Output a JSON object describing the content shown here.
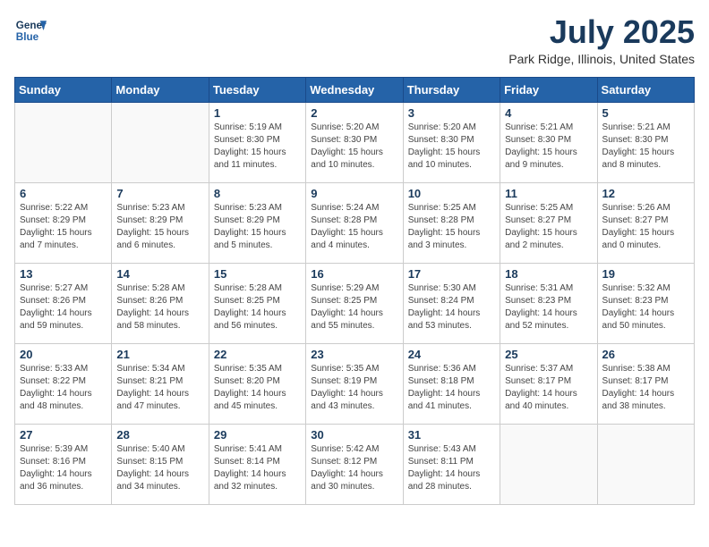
{
  "header": {
    "logo_line1": "General",
    "logo_line2": "Blue",
    "month": "July 2025",
    "location": "Park Ridge, Illinois, United States"
  },
  "weekdays": [
    "Sunday",
    "Monday",
    "Tuesday",
    "Wednesday",
    "Thursday",
    "Friday",
    "Saturday"
  ],
  "weeks": [
    [
      {
        "day": "",
        "info": ""
      },
      {
        "day": "",
        "info": ""
      },
      {
        "day": "1",
        "info": "Sunrise: 5:19 AM\nSunset: 8:30 PM\nDaylight: 15 hours and 11 minutes."
      },
      {
        "day": "2",
        "info": "Sunrise: 5:20 AM\nSunset: 8:30 PM\nDaylight: 15 hours and 10 minutes."
      },
      {
        "day": "3",
        "info": "Sunrise: 5:20 AM\nSunset: 8:30 PM\nDaylight: 15 hours and 10 minutes."
      },
      {
        "day": "4",
        "info": "Sunrise: 5:21 AM\nSunset: 8:30 PM\nDaylight: 15 hours and 9 minutes."
      },
      {
        "day": "5",
        "info": "Sunrise: 5:21 AM\nSunset: 8:30 PM\nDaylight: 15 hours and 8 minutes."
      }
    ],
    [
      {
        "day": "6",
        "info": "Sunrise: 5:22 AM\nSunset: 8:29 PM\nDaylight: 15 hours and 7 minutes."
      },
      {
        "day": "7",
        "info": "Sunrise: 5:23 AM\nSunset: 8:29 PM\nDaylight: 15 hours and 6 minutes."
      },
      {
        "day": "8",
        "info": "Sunrise: 5:23 AM\nSunset: 8:29 PM\nDaylight: 15 hours and 5 minutes."
      },
      {
        "day": "9",
        "info": "Sunrise: 5:24 AM\nSunset: 8:28 PM\nDaylight: 15 hours and 4 minutes."
      },
      {
        "day": "10",
        "info": "Sunrise: 5:25 AM\nSunset: 8:28 PM\nDaylight: 15 hours and 3 minutes."
      },
      {
        "day": "11",
        "info": "Sunrise: 5:25 AM\nSunset: 8:27 PM\nDaylight: 15 hours and 2 minutes."
      },
      {
        "day": "12",
        "info": "Sunrise: 5:26 AM\nSunset: 8:27 PM\nDaylight: 15 hours and 0 minutes."
      }
    ],
    [
      {
        "day": "13",
        "info": "Sunrise: 5:27 AM\nSunset: 8:26 PM\nDaylight: 14 hours and 59 minutes."
      },
      {
        "day": "14",
        "info": "Sunrise: 5:28 AM\nSunset: 8:26 PM\nDaylight: 14 hours and 58 minutes."
      },
      {
        "day": "15",
        "info": "Sunrise: 5:28 AM\nSunset: 8:25 PM\nDaylight: 14 hours and 56 minutes."
      },
      {
        "day": "16",
        "info": "Sunrise: 5:29 AM\nSunset: 8:25 PM\nDaylight: 14 hours and 55 minutes."
      },
      {
        "day": "17",
        "info": "Sunrise: 5:30 AM\nSunset: 8:24 PM\nDaylight: 14 hours and 53 minutes."
      },
      {
        "day": "18",
        "info": "Sunrise: 5:31 AM\nSunset: 8:23 PM\nDaylight: 14 hours and 52 minutes."
      },
      {
        "day": "19",
        "info": "Sunrise: 5:32 AM\nSunset: 8:23 PM\nDaylight: 14 hours and 50 minutes."
      }
    ],
    [
      {
        "day": "20",
        "info": "Sunrise: 5:33 AM\nSunset: 8:22 PM\nDaylight: 14 hours and 48 minutes."
      },
      {
        "day": "21",
        "info": "Sunrise: 5:34 AM\nSunset: 8:21 PM\nDaylight: 14 hours and 47 minutes."
      },
      {
        "day": "22",
        "info": "Sunrise: 5:35 AM\nSunset: 8:20 PM\nDaylight: 14 hours and 45 minutes."
      },
      {
        "day": "23",
        "info": "Sunrise: 5:35 AM\nSunset: 8:19 PM\nDaylight: 14 hours and 43 minutes."
      },
      {
        "day": "24",
        "info": "Sunrise: 5:36 AM\nSunset: 8:18 PM\nDaylight: 14 hours and 41 minutes."
      },
      {
        "day": "25",
        "info": "Sunrise: 5:37 AM\nSunset: 8:17 PM\nDaylight: 14 hours and 40 minutes."
      },
      {
        "day": "26",
        "info": "Sunrise: 5:38 AM\nSunset: 8:17 PM\nDaylight: 14 hours and 38 minutes."
      }
    ],
    [
      {
        "day": "27",
        "info": "Sunrise: 5:39 AM\nSunset: 8:16 PM\nDaylight: 14 hours and 36 minutes."
      },
      {
        "day": "28",
        "info": "Sunrise: 5:40 AM\nSunset: 8:15 PM\nDaylight: 14 hours and 34 minutes."
      },
      {
        "day": "29",
        "info": "Sunrise: 5:41 AM\nSunset: 8:14 PM\nDaylight: 14 hours and 32 minutes."
      },
      {
        "day": "30",
        "info": "Sunrise: 5:42 AM\nSunset: 8:12 PM\nDaylight: 14 hours and 30 minutes."
      },
      {
        "day": "31",
        "info": "Sunrise: 5:43 AM\nSunset: 8:11 PM\nDaylight: 14 hours and 28 minutes."
      },
      {
        "day": "",
        "info": ""
      },
      {
        "day": "",
        "info": ""
      }
    ]
  ]
}
